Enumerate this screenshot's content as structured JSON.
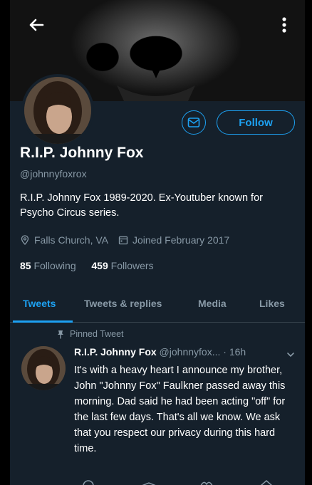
{
  "header": {
    "back_icon": "back-arrow-icon",
    "more_icon": "more-vertical-icon"
  },
  "profile": {
    "display_name": "R.I.P. Johnny Fox",
    "handle": "@johnnyfoxrox",
    "bio": "R.I.P. Johnny Fox 1989-2020. Ex-Youtuber known for Psycho Circus series.",
    "location": "Falls Church, VA",
    "joined": "Joined February 2017",
    "following_count": "85",
    "following_label": "Following",
    "followers_count": "459",
    "followers_label": "Followers",
    "follow_label": "Follow",
    "message_icon": "mail-icon"
  },
  "tabs": [
    {
      "label": "Tweets",
      "active": true
    },
    {
      "label": "Tweets & replies",
      "active": false
    },
    {
      "label": "Media",
      "active": false
    },
    {
      "label": "Likes",
      "active": false
    }
  ],
  "tweet": {
    "pinned_label": "Pinned Tweet",
    "author": "R.I.P. Johnny Fox",
    "handle": "@johnnyfox...",
    "separator": "·",
    "time": "16h",
    "text": "It's with a heavy heart I announce my brother, John \"Johnny Fox\" Faulkner passed away this morning. Dad said he had been acting \"off\" for the last few days. That's all we know. We ask that you respect our privacy during this hard time."
  },
  "colors": {
    "background": "#15202b",
    "accent": "#1da1f2",
    "muted_text": "#8899a6",
    "divider": "#38444d"
  }
}
